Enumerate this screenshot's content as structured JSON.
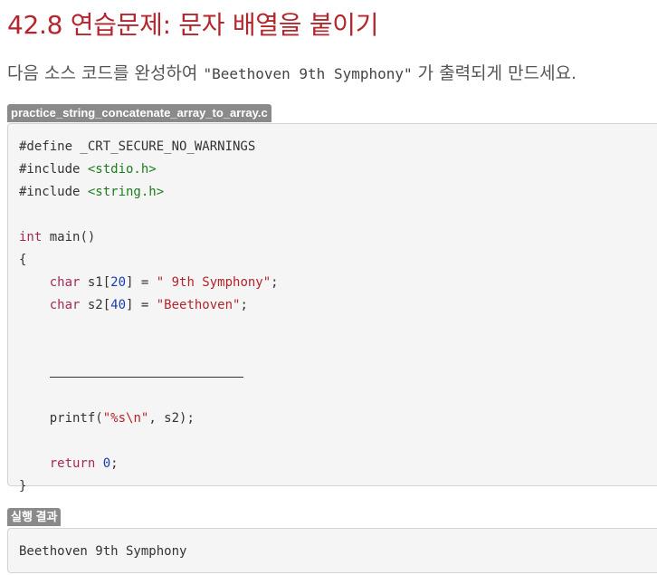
{
  "title": "42.8 연습문제: 문자 배열을 붙이기",
  "lead": {
    "before": "다음 소스 코드를 완성하여 ",
    "code": "\"Beethoven 9th Symphony\"",
    "after": " 가 출력되게 만드세요."
  },
  "source": {
    "filename": "practice_string_concatenate_array_to_array.c",
    "lines": {
      "l1": "#define _CRT_SECURE_NO_WARNINGS",
      "l2_a": "#include ",
      "l2_b": "<stdio.h>",
      "l3_a": "#include ",
      "l3_b": "<string.h>",
      "l5_a": "int",
      "l5_b": " main()",
      "l6": "{",
      "l7_a": "char",
      "l7_b": " s1[",
      "l7_c": "20",
      "l7_d": "] = ",
      "l7_e": "\" 9th Symphony\"",
      "l7_f": ";",
      "l8_a": "char",
      "l8_b": " s2[",
      "l8_c": "40",
      "l8_d": "] = ",
      "l8_e": "\"Beethoven\"",
      "l8_f": ";",
      "l12_a": "printf(",
      "l12_b": "\"%s\\n\"",
      "l12_c": ", s2);",
      "l14_a": "return",
      "l14_b": " 0",
      "l14_c": ";",
      "l15": "}"
    }
  },
  "result": {
    "label": "실행 결과",
    "output": "Beethoven 9th Symphony"
  },
  "colors": {
    "title": "#b3262e",
    "keyword": "#a52a5a",
    "string": "#b5242b",
    "number": "#1a3bb3",
    "include": "#1d7d1d",
    "label_bg": "#8a8a8a"
  }
}
